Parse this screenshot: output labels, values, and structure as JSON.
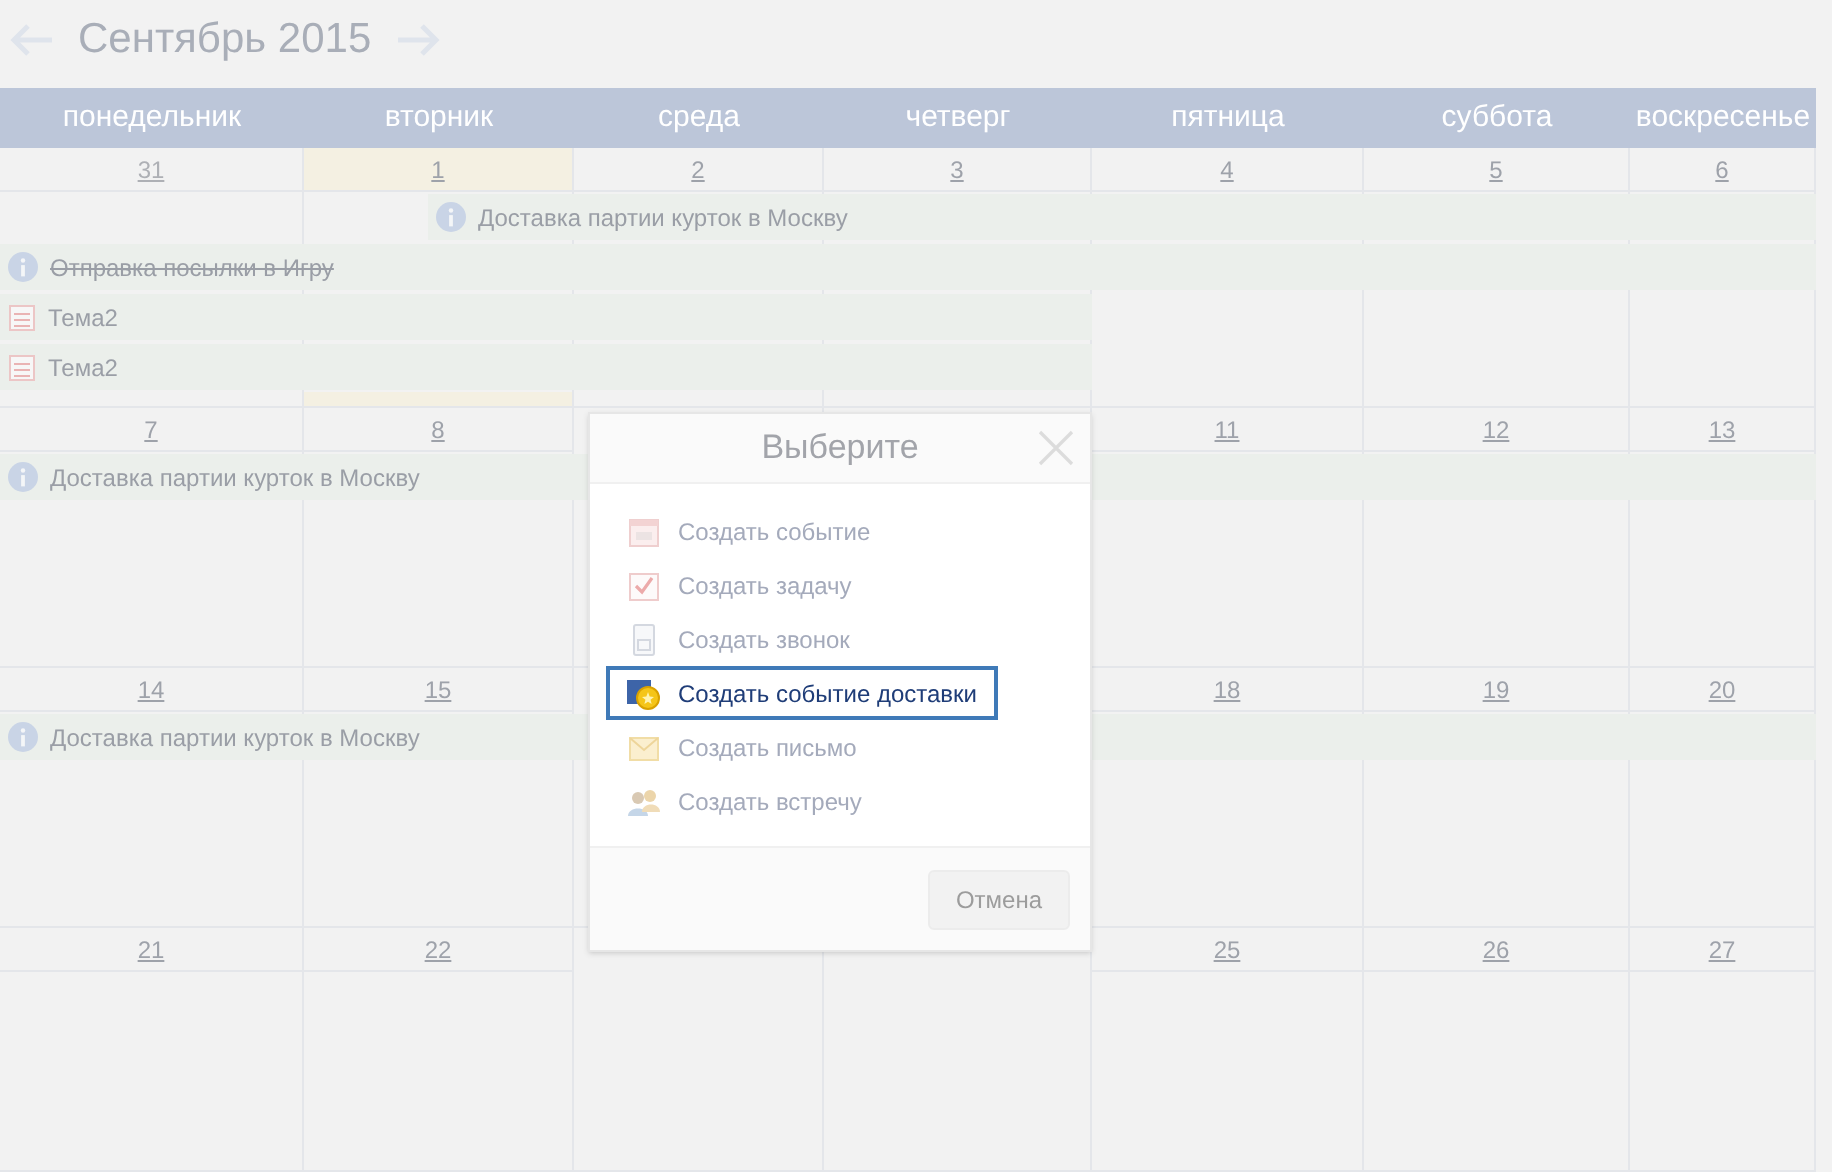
{
  "header": {
    "title": "Сентябрь 2015"
  },
  "weekdays": [
    "понедельник",
    "вторник",
    "среда",
    "четверг",
    "пятница",
    "суббота",
    "воскресенье"
  ],
  "weeks": [
    {
      "days": [
        {
          "label": "31",
          "outside": true,
          "today": false,
          "events": [
            {
              "kind": "delivery",
              "title": "Отправка посылки в Игру",
              "done": true
            },
            {
              "kind": "topic",
              "title": "Тема2",
              "done": false
            },
            {
              "kind": "topic",
              "title": "Тема2",
              "done": false
            }
          ]
        },
        {
          "label": "1",
          "outside": false,
          "today": true,
          "events": [
            {
              "kind": "delivery",
              "title": "Доставка партии курток в Москву",
              "done": false
            }
          ]
        },
        {
          "label": "2",
          "outside": false,
          "today": false
        },
        {
          "label": "3",
          "outside": false,
          "today": false
        },
        {
          "label": "4",
          "outside": false,
          "today": false
        },
        {
          "label": "5",
          "outside": false,
          "today": false
        },
        {
          "label": "6",
          "outside": false,
          "today": false
        }
      ]
    },
    {
      "days_before_dialog": [
        {
          "label": "7",
          "outside": false,
          "today": false,
          "events": [
            {
              "kind": "delivery",
              "title": "Доставка партии курток в Москву",
              "done": false
            }
          ]
        },
        {
          "label": "8",
          "outside": false,
          "today": false
        }
      ],
      "days_after_dialog": [
        {
          "label": "11",
          "outside": false,
          "today": false
        },
        {
          "label": "12",
          "outside": false,
          "today": false
        },
        {
          "label": "13",
          "outside": false,
          "today": false
        }
      ]
    },
    {
      "days_before_dialog": [
        {
          "label": "14",
          "outside": false,
          "today": false,
          "events": [
            {
              "kind": "delivery",
              "title": "Доставка партии курток в Москву",
              "done": false
            }
          ]
        },
        {
          "label": "15",
          "outside": false,
          "today": false
        }
      ],
      "days_after_dialog": [
        {
          "label": "18",
          "outside": false,
          "today": false
        },
        {
          "label": "19",
          "outside": false,
          "today": false
        },
        {
          "label": "20",
          "outside": false,
          "today": false
        }
      ]
    },
    {
      "days_before_dialog": [
        {
          "label": "21",
          "outside": false,
          "today": false
        },
        {
          "label": "22",
          "outside": false,
          "today": false
        }
      ],
      "days_after_dialog": [
        {
          "label": "25",
          "outside": false,
          "today": false
        },
        {
          "label": "26",
          "outside": false,
          "today": false
        },
        {
          "label": "27",
          "outside": false,
          "today": false
        }
      ]
    }
  ],
  "dialog": {
    "title": "Выберите",
    "items": [
      {
        "kind": "event",
        "label": "Создать событие",
        "selected": false
      },
      {
        "kind": "task",
        "label": "Создать задачу",
        "selected": false
      },
      {
        "kind": "call",
        "label": "Создать звонок",
        "selected": false
      },
      {
        "kind": "delivery",
        "label": "Создать событие доставки",
        "selected": true
      },
      {
        "kind": "letter",
        "label": "Создать письмо",
        "selected": false
      },
      {
        "kind": "meeting",
        "label": "Создать встречу",
        "selected": false
      }
    ],
    "cancel": "Отмена"
  }
}
